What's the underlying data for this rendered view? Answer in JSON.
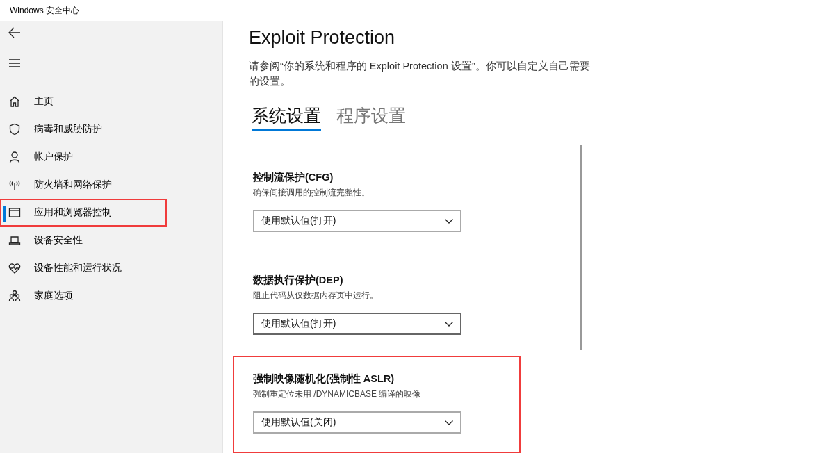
{
  "window": {
    "title": "Windows 安全中心"
  },
  "sidebar": {
    "items": [
      {
        "kind": "home",
        "label": "主页",
        "selected": false,
        "highlighted": false
      },
      {
        "kind": "shield",
        "label": "病毒和威胁防护",
        "selected": false,
        "highlighted": false
      },
      {
        "kind": "person",
        "label": "帐户保护",
        "selected": false,
        "highlighted": false
      },
      {
        "kind": "antenna",
        "label": "防火墙和网络保护",
        "selected": false,
        "highlighted": false
      },
      {
        "kind": "window",
        "label": "应用和浏览器控制",
        "selected": true,
        "highlighted": true
      },
      {
        "kind": "laptop",
        "label": "设备安全性",
        "selected": false,
        "highlighted": false
      },
      {
        "kind": "heart",
        "label": "设备性能和运行状况",
        "selected": false,
        "highlighted": false
      },
      {
        "kind": "family",
        "label": "家庭选项",
        "selected": false,
        "highlighted": false
      }
    ]
  },
  "page": {
    "title": "Exploit Protection",
    "description": "请参阅“你的系统和程序的 Exploit Protection 设置”。你可以自定义自己需要的设置。"
  },
  "tabs": [
    {
      "label": "系统设置",
      "selected": true
    },
    {
      "label": "程序设置",
      "selected": false
    }
  ],
  "settings": [
    {
      "title": "控制流保护(CFG)",
      "description": "确保间接调用的控制流完整性。",
      "value": "使用默认值(打开)",
      "focused": false,
      "highlighted": false
    },
    {
      "title": "数据执行保护(DEP)",
      "description": "阻止代码从仅数据内存页中运行。",
      "value": "使用默认值(打开)",
      "focused": true,
      "highlighted": false
    },
    {
      "title": "强制映像随机化(强制性 ASLR)",
      "description": "强制重定位未用 /DYNAMICBASE 编译的映像",
      "value": "使用默认值(关闭)",
      "focused": false,
      "highlighted": true
    }
  ]
}
